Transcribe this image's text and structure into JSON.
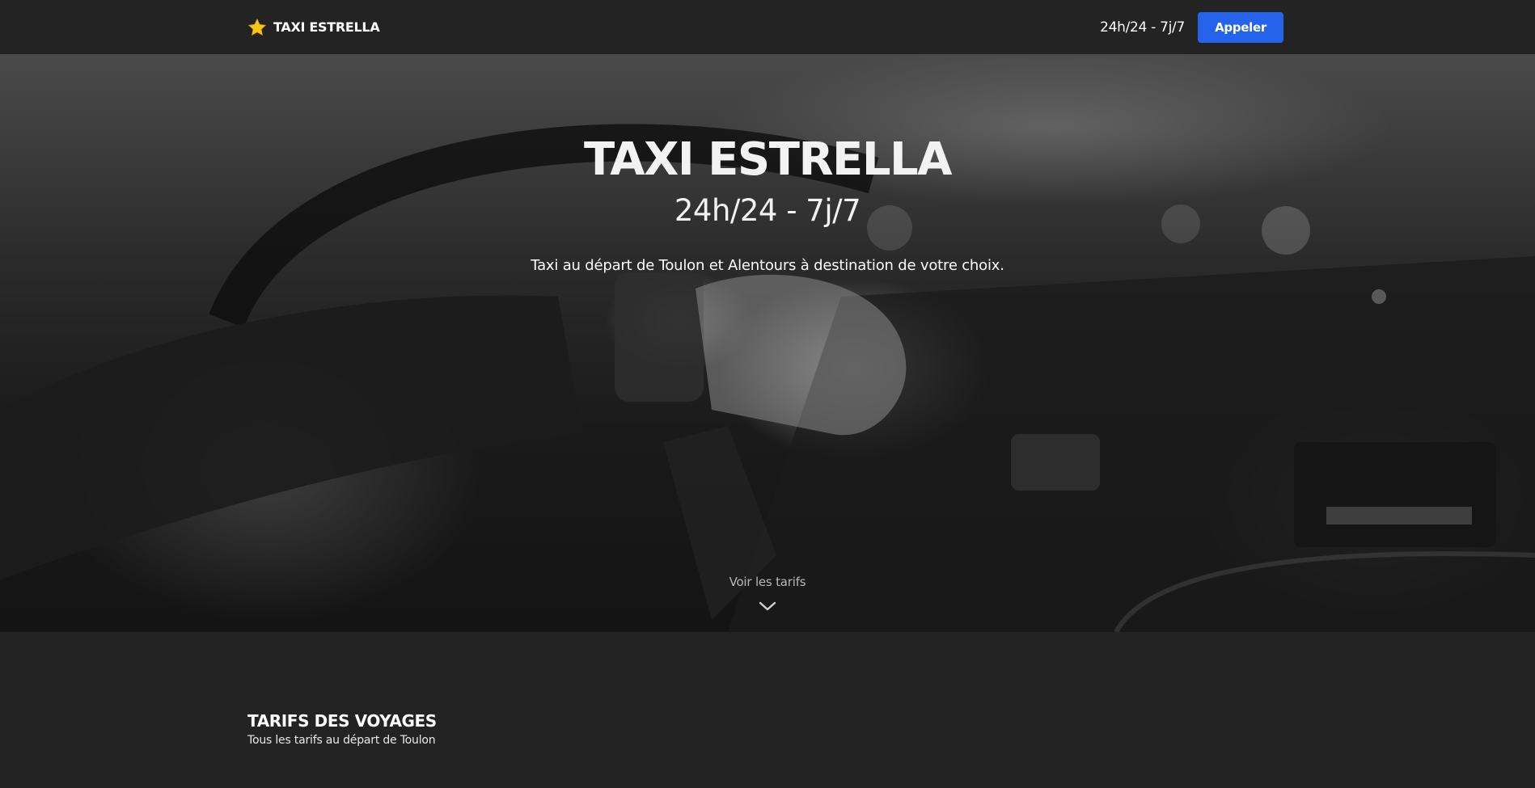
{
  "navbar": {
    "brand_name": "TAXI ESTRELLA",
    "brand_icon": "star-icon",
    "hours": "24h/24 - 7j/7",
    "call_button": "Appeler"
  },
  "hero": {
    "title": "TAXI ESTRELLA",
    "hours": "24h/24 - 7j/7",
    "tagline": "Taxi au départ de Toulon et Alentours à destination de votre choix.",
    "see_prices_label": "Voir les tarifs",
    "see_prices_icon": "chevron-down-icon"
  },
  "tarifs": {
    "title": "TARIFS DES VOYAGES",
    "subtitle": "Tous les tarifs au départ de Toulon"
  },
  "colors": {
    "page_background": "#232323",
    "accent": "#2563eb",
    "star": "#f5c518"
  }
}
